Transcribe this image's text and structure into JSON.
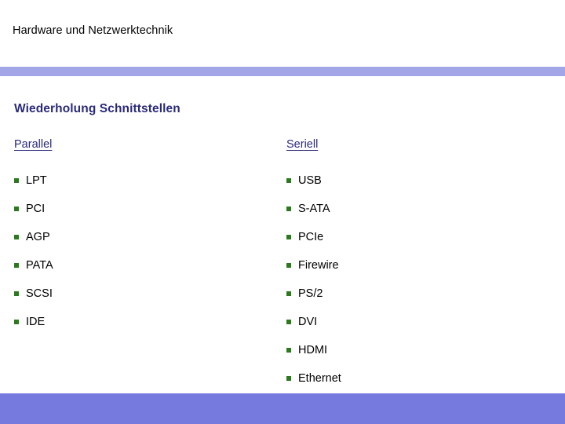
{
  "slide": {
    "header": {
      "title": "Hardware und Netzwerktechnik",
      "rule_color": "#a3a6e6"
    },
    "content": {
      "heading": "Wiederholung Schnittstellen",
      "heading_color": "#2a2a7a",
      "bullet_color": "#2c7a1e",
      "columns": [
        {
          "heading": "Parallel",
          "items": [
            "LPT",
            "PCI",
            "AGP",
            "PATA",
            "SCSI",
            "IDE"
          ]
        },
        {
          "heading": "Seriell",
          "items": [
            "USB",
            "S-ATA",
            "PCIe",
            "Firewire",
            "PS/2",
            "DVI",
            "HDMI",
            "Ethernet"
          ]
        }
      ]
    },
    "footer": {
      "color": "#7679dd"
    }
  }
}
